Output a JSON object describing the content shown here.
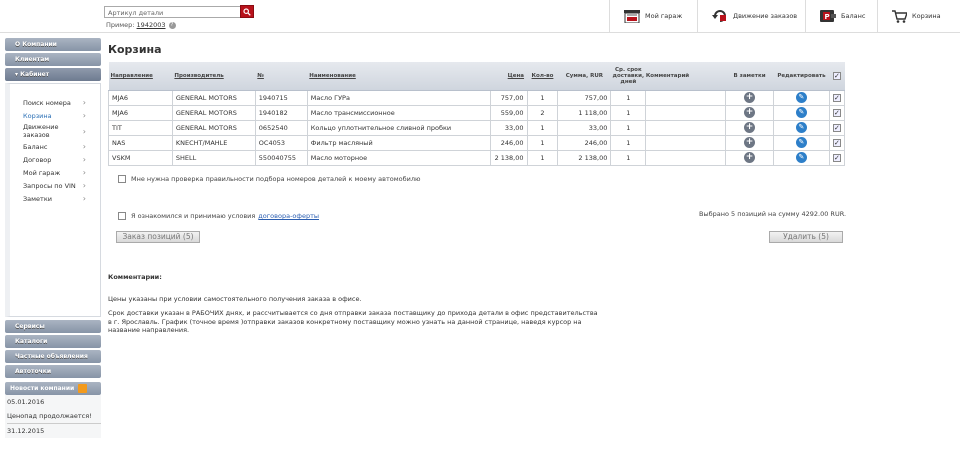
{
  "search": {
    "placeholder": "Артикул детали",
    "example_prefix": "Пример:",
    "example_value": "1942003",
    "help": "?"
  },
  "topnav": {
    "garage": "Мой гараж",
    "orders": "Движение заказов",
    "balance": "Баланс",
    "cart": "Корзина"
  },
  "sidebar": {
    "sections": [
      "О Компании",
      "Клиентам",
      "Кабинет"
    ],
    "cabinet_items": [
      {
        "label": "Поиск номера"
      },
      {
        "label": "Корзина"
      },
      {
        "label": "Движение заказов"
      },
      {
        "label": "Баланс"
      },
      {
        "label": "Договор"
      },
      {
        "label": "Мой гараж"
      },
      {
        "label": "Запросы по VIN"
      },
      {
        "label": "Заметки"
      }
    ],
    "bottom_sections": [
      "Сервисы",
      "Каталоги",
      "Частные объявления",
      "Автоточки"
    ],
    "news_title": "Новости компании",
    "news": [
      {
        "date": "05.01.2016",
        "text": "Ценопад продолжается!"
      },
      {
        "date": "31.12.2015"
      }
    ]
  },
  "page_title": "Корзина",
  "table": {
    "headers": {
      "direction": "Направление",
      "maker": "Производитель",
      "number": "№",
      "name": "Наименование",
      "price": "Цена",
      "qty": "Кол-во",
      "sum": "Сумма, RUR",
      "delivery": "Ср. срок доставки, дней",
      "comment": "Комментарий",
      "notes": "В заметки",
      "edit": "Редактировать"
    },
    "rows": [
      {
        "direction": "MJA6",
        "maker": "GENERAL MOTORS",
        "number": "1940715",
        "name": "Масло ГУРа",
        "price": "757,00",
        "qty": "1",
        "sum": "757,00",
        "days": "1"
      },
      {
        "direction": "MJA6",
        "maker": "GENERAL MOTORS",
        "number": "1940182",
        "name": "Масло трансмиссионное",
        "price": "559,00",
        "qty": "2",
        "sum": "1 118,00",
        "days": "1"
      },
      {
        "direction": "TIT",
        "maker": "GENERAL MOTORS",
        "number": "0652540",
        "name": "Кольцо уплотнительное сливной пробки",
        "price": "33,00",
        "qty": "1",
        "sum": "33,00",
        "days": "1"
      },
      {
        "direction": "NAS",
        "maker": "KNECHT/MAHLE",
        "number": "OC4053",
        "name": "Фильтр масляный",
        "price": "246,00",
        "qty": "1",
        "sum": "246,00",
        "days": "1"
      },
      {
        "direction": "VSKM",
        "maker": "SHELL",
        "number": "550040755",
        "name": "Масло моторное",
        "price": "2 138,00",
        "qty": "1",
        "sum": "2 138,00",
        "days": "1"
      }
    ]
  },
  "verify_label": "Мне нужна проверка правильности подбора номеров деталей к моему автомобилю",
  "agree_label": "Я ознакомился и принимаю условия",
  "agree_link": "договора-оферты",
  "selected_text": "Выбрано 5 позиций на сумму 4292.00 RUR.",
  "order_button": "Заказ позиций (5)",
  "delete_button": "Удалить (5)",
  "comments": {
    "title": "Комментарии:",
    "p1": "Цены указаны при условии самостоятельного получения заказа в офисе.",
    "p2": "Срок доставки указан в РАБОЧИХ днях, и рассчитывается со дня отправки заказа поставщику до прихода детали в офис представительства в г. Ярославль. График (точное время )отправки заказов конкретному поставщику можно узнать на данной странице, наведя курсор на название направления."
  },
  "colors": {
    "accent_red": "#b8121b",
    "link_blue": "#2a5db0",
    "sidebar_gray": "#8794a7"
  }
}
